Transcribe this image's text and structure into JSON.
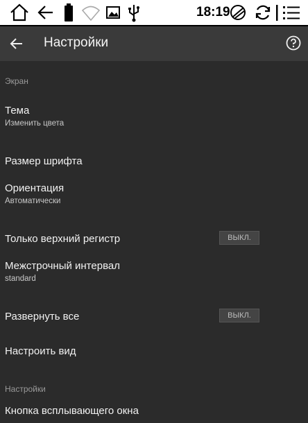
{
  "status_bar": {
    "time": "18:19",
    "icons": [
      "home-icon",
      "back-arrow-icon",
      "battery-icon",
      "wifi-icon",
      "image-icon",
      "usb-icon",
      "sync-refresh-icon",
      "rotate-icon",
      "menu-icon"
    ]
  },
  "app_bar": {
    "title": "Настройки"
  },
  "sections": {
    "screen": {
      "header": "Экран",
      "items": {
        "theme": {
          "title": "Тема",
          "subtitle": "Изменить цвета"
        },
        "font_size": {
          "title": "Размер шрифта"
        },
        "orientation": {
          "title": "Ориентация",
          "subtitle": "Автоматически"
        },
        "uppercase": {
          "title": "Только верхний регистр",
          "toggle": "ВЫКЛ."
        },
        "line_spacing": {
          "title": "Межстрочный интервал",
          "subtitle": "standard"
        },
        "expand_all": {
          "title": "Развернуть все",
          "toggle": "ВЫКЛ."
        },
        "customize_view": {
          "title": "Настроить вид"
        }
      }
    },
    "settings": {
      "header": "Настройки",
      "items": {
        "popup_button": {
          "title": "Кнопка всплывающего окна"
        }
      }
    }
  },
  "colors": {
    "background": "#2b2b2b",
    "app_bar": "#3a3a3a",
    "status_bar": "#ffffff"
  }
}
